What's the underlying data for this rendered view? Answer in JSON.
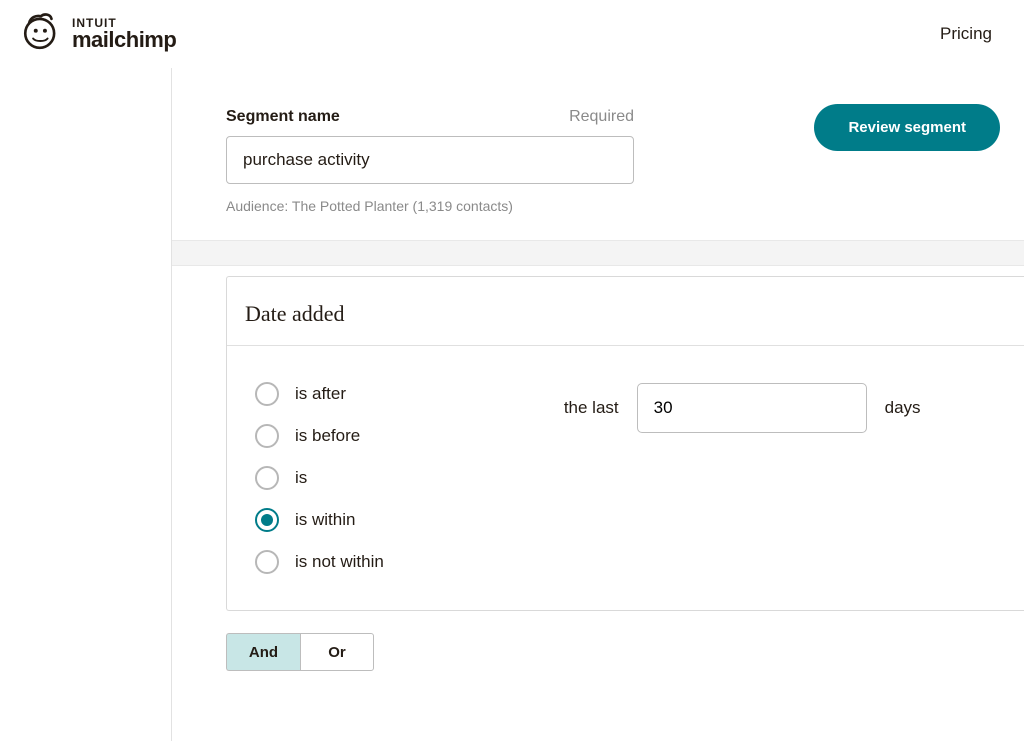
{
  "header": {
    "brand_prefix": "INTUIT",
    "brand_name": "mailchimp",
    "pricing": "Pricing"
  },
  "segment": {
    "label": "Segment name",
    "required": "Required",
    "value": "purchase activity",
    "audience": "Audience: The Potted Planter (1,319 contacts)",
    "review_btn": "Review segment"
  },
  "panel": {
    "title": "Date added",
    "radios": [
      "is after",
      "is before",
      "is",
      "is within",
      "is not within"
    ],
    "selected_index": 3,
    "range_prefix": "the last",
    "range_value": "30",
    "range_suffix": "days"
  },
  "logic": {
    "and": "And",
    "or": "Or"
  }
}
